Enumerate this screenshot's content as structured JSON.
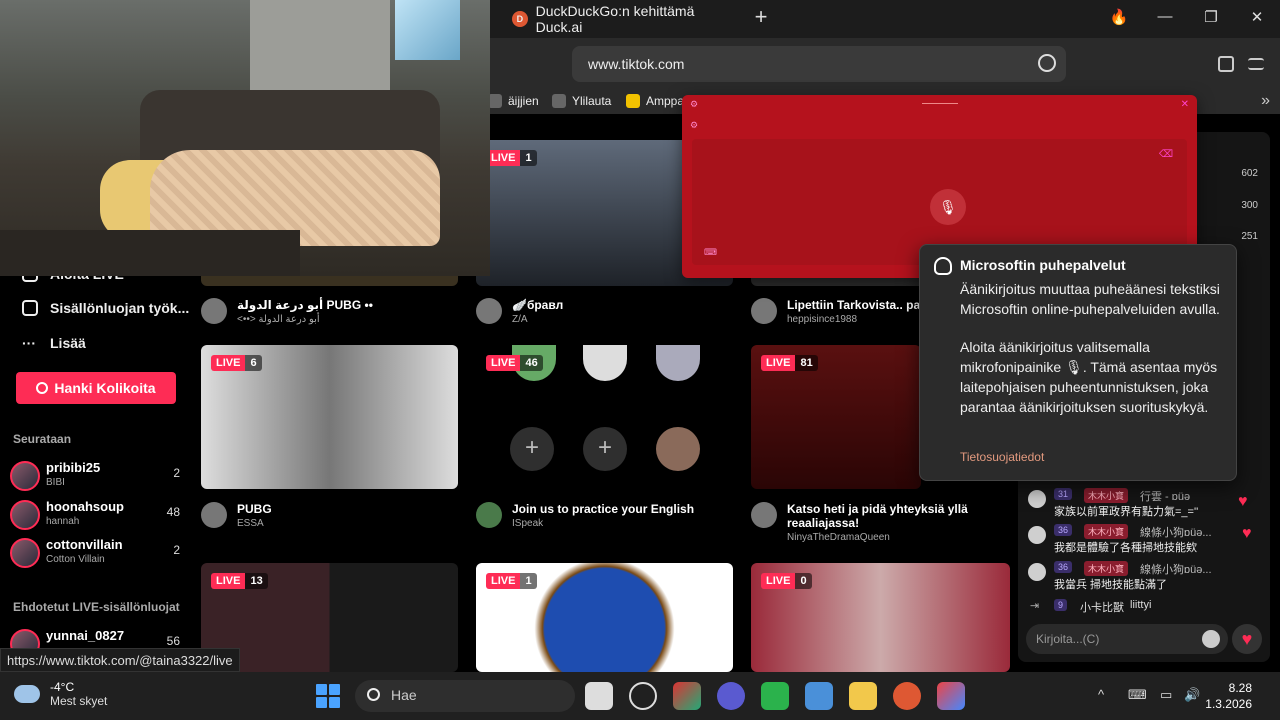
{
  "browser": {
    "tab_title": "DuckDuckGo:n kehittämä Duck.ai",
    "tab_icon": "duckduckgo-icon",
    "new_tab": "+",
    "url": "www.tiktok.com",
    "bookmarks": [
      "äijjien",
      "Ylilauta",
      "Amppa"
    ],
    "window_controls": [
      "—",
      "❐",
      "✕"
    ],
    "fire": "🔥"
  },
  "sidebar": {
    "items": [
      {
        "label": "Aloita LIVE",
        "icon": "live-icon"
      },
      {
        "label": "Sisällönluojan työk...",
        "icon": "creator-tools-icon"
      },
      {
        "label": "Lisää",
        "icon": "more-icon"
      }
    ],
    "coins_button": "Hanki Kolikoita",
    "following_title": "Seurataan",
    "following": [
      {
        "name": "pribibi25",
        "sub": "BIBI",
        "count": "2"
      },
      {
        "name": "hoonahsoup",
        "sub": "hannah",
        "count": "48"
      },
      {
        "name": "cottonvillain",
        "sub": "Cotton Villain",
        "count": "2"
      }
    ],
    "suggested_title": "Ehdotetut LIVE-sisällönluojat",
    "suggested": [
      {
        "name": "yunnai_0827",
        "count": "56"
      }
    ]
  },
  "grid": {
    "row1": [
      {
        "title": "أبو درعة الدولة PUBG ••",
        "sub": "<••> أبو درعة الدولة"
      },
      {
        "title": "🪽бравл",
        "sub": "Z/A",
        "live": "LIVE",
        "viewers": "1"
      },
      {
        "title": "Lipettiin Tarkovista.. part",
        "sub": "heppisince1988"
      }
    ],
    "row2": [
      {
        "title": "PUBG",
        "sub": "ESSA",
        "live": "LIVE",
        "viewers": "6"
      },
      {
        "title": "Join us to practice your English",
        "sub": "ISpeak",
        "live": "LIVE",
        "viewers": "46"
      },
      {
        "title": "Katso heti ja pidä yhteyksiä yllä",
        "title2": "reaaliajassa!",
        "sub": "NinyaTheDramaQueen",
        "live": "LIVE",
        "viewers": "81"
      }
    ],
    "row3": [
      {
        "live": "LIVE",
        "viewers": "13"
      },
      {
        "live": "LIVE",
        "viewers": "1"
      },
      {
        "live": "LIVE",
        "viewers": "0"
      }
    ]
  },
  "right_stats": [
    "602",
    "300",
    "251"
  ],
  "voice_panel": {
    "tooltip_title": "Microsoftin puhepalvelut",
    "tooltip_p1": "Äänikirjoitus muuttaa puheäänesi tekstiksi Microsoftin online-puhepalveluiden avulla.",
    "tooltip_p2": "Aloita äänikirjoitus valitsemalla mikrofonipainike 🎙. Tämä asentaa myös laitepohjaisen puheentunnistuksen, joka parantaa äänikirjoituksen suorituskykyä.",
    "tooltip_link": "Tietosuojatiedot"
  },
  "chat": {
    "messages": [
      {
        "level": "31",
        "tag": "木木小寶",
        "user": "行雲 - ɒüǝ",
        "text": "家族以前軍政界有點力氣=_=''"
      },
      {
        "level": "36",
        "tag": "木木小寶",
        "user": "線條小狗ɒüǝ...",
        "text": "我都是體驗了各種掃地技能欸"
      },
      {
        "level": "36",
        "tag": "木木小寶",
        "user": "線條小狗ɒüǝ...",
        "text": "我當兵 掃地技能點滿了"
      }
    ],
    "join": {
      "level": "9",
      "user": "小卡比獸",
      "action": "liittyi"
    },
    "input_placeholder": "Kirjoita...(C)"
  },
  "status_link": "https://www.tiktok.com/@taina3322/live",
  "taskbar": {
    "temp": "-4°C",
    "weather": "Mest skyet",
    "search": "Hae",
    "time": "8.28",
    "date": "1.3.2026"
  },
  "colors": {
    "accent": "#fe2c55",
    "voice_panel": "#b5121d"
  }
}
